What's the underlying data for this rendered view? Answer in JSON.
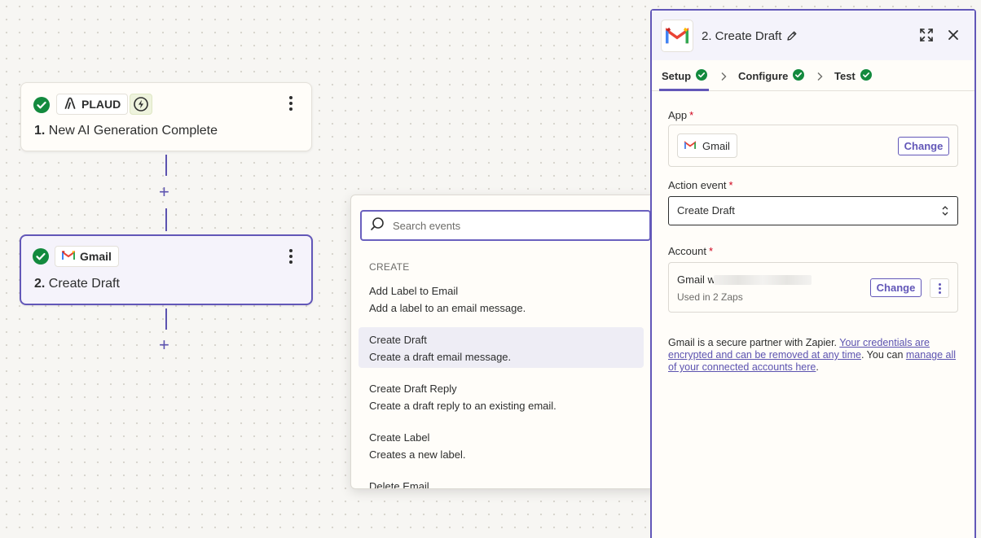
{
  "canvas": {
    "step1": {
      "app_name": "PLAUD",
      "number": "1.",
      "title": "New AI Generation Complete"
    },
    "step2": {
      "app_name": "Gmail",
      "number": "2.",
      "title": "Create Draft"
    }
  },
  "event_dropdown": {
    "search_placeholder": "Search events",
    "group_label": "CREATE",
    "options": [
      {
        "title": "Add Label to Email",
        "desc": "Add a label to an email message."
      },
      {
        "title": "Create Draft",
        "desc": "Create a draft email message."
      },
      {
        "title": "Create Draft Reply",
        "desc": "Create a draft reply to an existing email."
      },
      {
        "title": "Create Label",
        "desc": "Creates a new label."
      },
      {
        "title": "Delete Email",
        "desc": ""
      }
    ]
  },
  "panel": {
    "title": "2. Create Draft",
    "tabs": [
      "Setup",
      "Configure",
      "Test"
    ],
    "app_label": "App",
    "app_value": "Gmail",
    "change_label": "Change",
    "action_event_label": "Action event",
    "action_event_value": "Create Draft",
    "account_label": "Account",
    "account_name": "Gmail w",
    "account_used": "Used in 2 Zaps",
    "secure_text_1": "Gmail is a secure partner with Zapier. ",
    "secure_link_1": "Your credentials are encrypted and can be removed at any time",
    "secure_text_2": ". You can ",
    "secure_link_2": "manage all of your connected accounts here",
    "secure_text_3": "."
  },
  "colors": {
    "accent": "#6257b8",
    "success": "#138a3e",
    "gmail_red": "#ea4335"
  }
}
